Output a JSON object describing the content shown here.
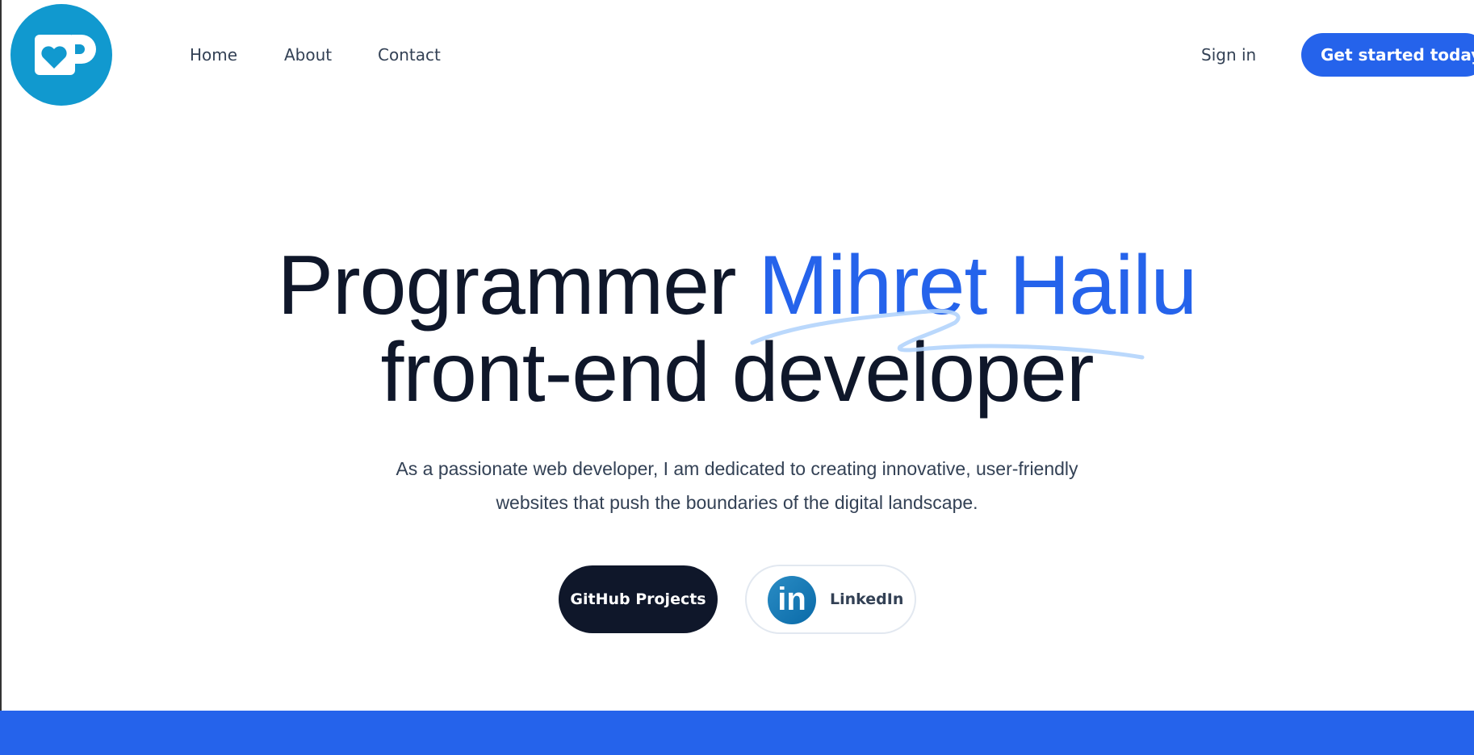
{
  "header": {
    "logo_icon": "heart-mug-icon",
    "nav": [
      {
        "label": "Home"
      },
      {
        "label": "About"
      },
      {
        "label": "Contact"
      }
    ],
    "sign_in": "Sign in",
    "cta": "Get started today"
  },
  "hero": {
    "title_prefix": "Programmer",
    "title_highlight": "Mihret Hailu",
    "title_line2": "front-end developer",
    "lead_line1": "As a passionate web developer, I am dedicated to creating innovative, user-friendly",
    "lead_line2": "websites that push the boundaries of the digital landscape.",
    "github_button": "GitHub Projects",
    "linkedin_button": "LinkedIn",
    "linkedin_icon_text": "in"
  },
  "colors": {
    "accent": "#2563eb",
    "dark": "#0f172a",
    "logo": "#1199cf",
    "swoosh": "#b3d4fc"
  }
}
